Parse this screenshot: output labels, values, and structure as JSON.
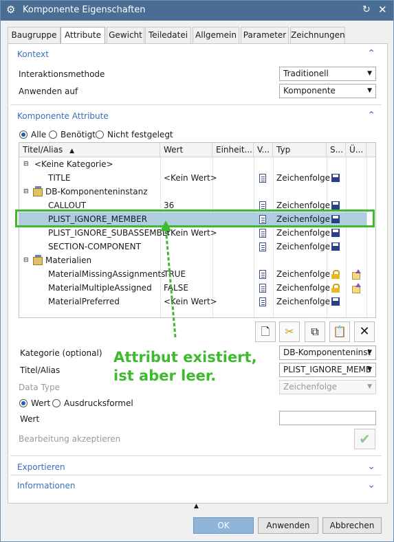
{
  "window": {
    "title": "Komponente Eigenschaften"
  },
  "tabs": [
    "Baugruppe",
    "Attribute",
    "Gewicht",
    "Teiledatei",
    "Allgemein",
    "Parameter",
    "Zeichnungen"
  ],
  "kontext": {
    "header": "Kontext",
    "interaktionsmethode_label": "Interaktionsmethode",
    "interaktionsmethode_value": "Traditionell",
    "anwenden_label": "Anwenden auf",
    "anwenden_value": "Komponente"
  },
  "attribute_section": {
    "header": "Komponente Attribute",
    "filter_all": "Alle",
    "filter_required": "Benötigt",
    "filter_unset": "Nicht festgelegt"
  },
  "table": {
    "columns": [
      "Titel/Alias",
      "Wert",
      "Einheit...",
      "V...",
      "Typ",
      "S...",
      "Ü..."
    ],
    "rows": [
      {
        "kind": "group",
        "title": "<Keine Kategorie>"
      },
      {
        "kind": "attr",
        "title": "TITLE",
        "wert": "<Kein Wert>",
        "typ": "Zeichenfolge",
        "s": "save",
        "u": ""
      },
      {
        "kind": "group",
        "title": "DB-Komponenteninstanz"
      },
      {
        "kind": "attr",
        "title": "CALLOUT",
        "wert": "36",
        "typ": "Zeichenfolge",
        "s": "save",
        "u": ""
      },
      {
        "kind": "attr",
        "title": "PLIST_IGNORE_MEMBER",
        "wert": "",
        "typ": "Zeichenfolge",
        "s": "save",
        "u": "",
        "selected": true
      },
      {
        "kind": "attr",
        "title": "PLIST_IGNORE_SUBASSEMBLY",
        "wert": "<Kein Wert>",
        "typ": "Zeichenfolge",
        "s": "save",
        "u": ""
      },
      {
        "kind": "attr",
        "title": "SECTION-COMPONENT",
        "wert": "",
        "typ": "Zeichenfolge",
        "s": "save",
        "u": ""
      },
      {
        "kind": "group",
        "title": "Materialien"
      },
      {
        "kind": "attr",
        "title": "MaterialMissingAssignments",
        "wert": "TRUE",
        "typ": "Zeichenfolge",
        "s": "lock",
        "u": "edit"
      },
      {
        "kind": "attr",
        "title": "MaterialMultipleAssigned",
        "wert": "FALSE",
        "typ": "Zeichenfolge",
        "s": "lock",
        "u": "edit"
      },
      {
        "kind": "attr",
        "title": "MaterialPreferred",
        "wert": "<Kein Wert>",
        "typ": "Zeichenfolge",
        "s": "save",
        "u": ""
      }
    ]
  },
  "details": {
    "kategorie_label": "Kategorie (optional)",
    "kategorie_value": "DB-Komponenteninst",
    "titel_label": "Titel/Alias",
    "titel_value": "PLIST_IGNORE_MEMB",
    "datatype_label": "Data Type",
    "datatype_value": "Zeichenfolge",
    "wert_radio": "Wert",
    "formel_radio": "Ausdrucksformel",
    "wert_label": "Wert",
    "wert_value": "",
    "accept_label": "Bearbeitung akzeptieren"
  },
  "annotation": {
    "text_line1": "Attribut existiert,",
    "text_line2": "ist aber leer."
  },
  "collapsed_sections": {
    "exportieren": "Exportieren",
    "informationen": "Informationen"
  },
  "footer": {
    "ok": "OK",
    "anwenden": "Anwenden",
    "abbrechen": "Abbrechen"
  },
  "colors": {
    "title_bar": "#4a6d94",
    "accent": "#3b6fb6",
    "selected_row": "#aecde0",
    "annotation": "#3dba2e"
  }
}
